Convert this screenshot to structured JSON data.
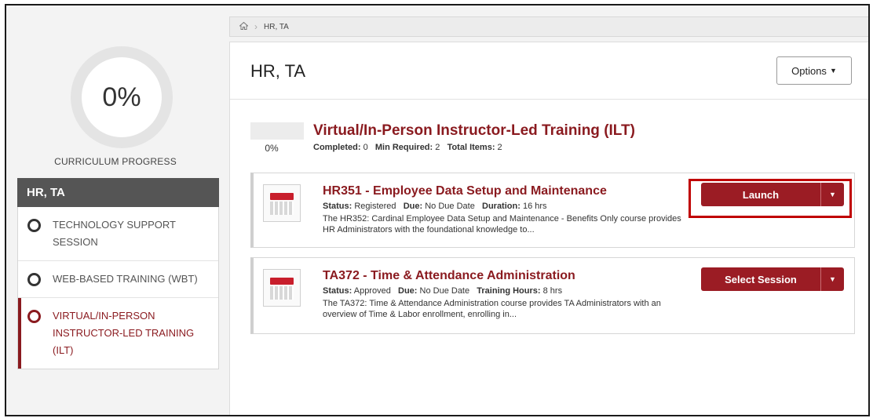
{
  "sidebar": {
    "progress_value": "0%",
    "progress_caption": "CURRICULUM PROGRESS",
    "curriculum_title": "HR, TA",
    "items": [
      {
        "label": "TECHNOLOGY SUPPORT SESSION",
        "active": false
      },
      {
        "label": "WEB-BASED TRAINING (WBT)",
        "active": false
      },
      {
        "label": "VIRTUAL/IN-PERSON INSTRUCTOR-LED TRAINING (ILT)",
        "active": true
      }
    ]
  },
  "breadcrumb": {
    "home_icon": "home-icon",
    "current": "HR, TA"
  },
  "main": {
    "title": "HR, TA",
    "options_label": "Options",
    "section": {
      "progress_value": "0%",
      "progress_fraction": 0,
      "title": "Virtual/In-Person Instructor-Led Training (ILT)",
      "completed_label": "Completed:",
      "completed_value": "0",
      "min_required_label": "Min Required:",
      "min_required_value": "2",
      "total_items_label": "Total Items:",
      "total_items_value": "2"
    },
    "courses": [
      {
        "name": "HR351 - Employee Data Setup and Maintenance",
        "status_label": "Status:",
        "status_value": "Registered",
        "due_label": "Due:",
        "due_value": "No Due Date",
        "extra_label": "Duration:",
        "extra_value": "16 hrs",
        "description": "The HR352: Cardinal Employee Data Setup and Maintenance - Benefits Only course provides HR Administrators with the foundational knowledge to...",
        "action_label": "Launch"
      },
      {
        "name": "TA372 - Time & Attendance Administration",
        "status_label": "Status:",
        "status_value": "Approved",
        "due_label": "Due:",
        "due_value": "No Due Date",
        "extra_label": "Training Hours:",
        "extra_value": "8 hrs",
        "description": "The TA372: Time & Attendance Administration course provides TA Administrators with an overview of Time & Labor enrollment, enrolling in...",
        "action_label": "Select Session"
      }
    ]
  },
  "colors": {
    "accent": "#8a1a1f",
    "button": "#9b1c24",
    "highlight": "#c00000",
    "sidebar_header": "#555555"
  }
}
